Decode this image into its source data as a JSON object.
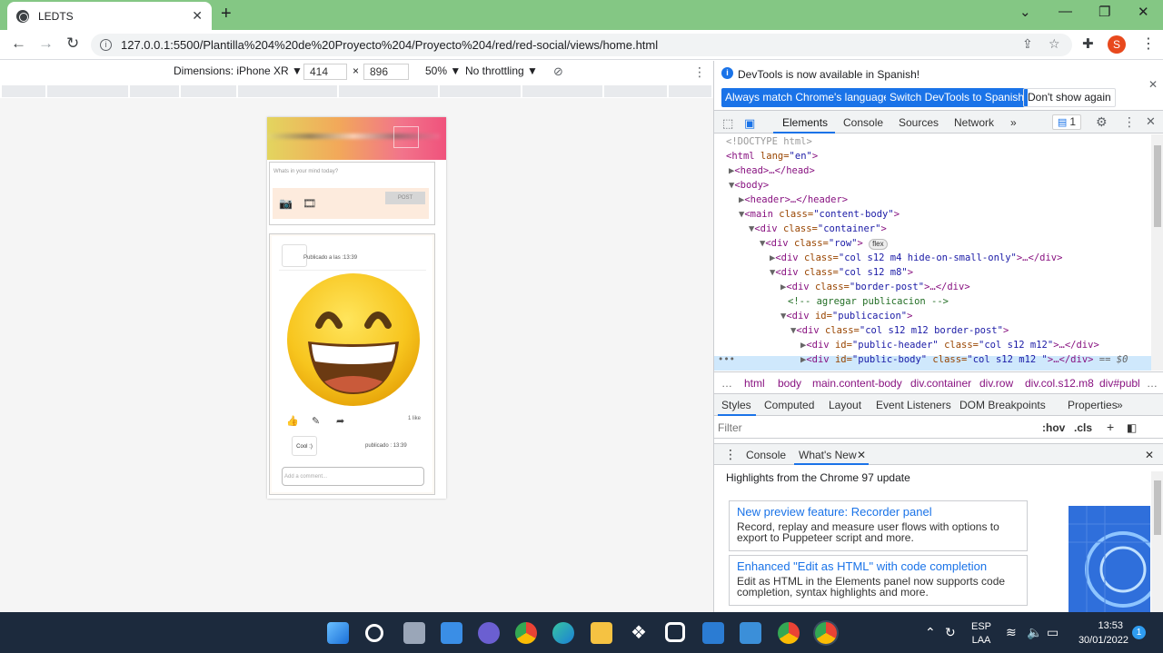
{
  "browser": {
    "tab_title": "LEDTS",
    "tab_close": "✕",
    "new_tab": "+",
    "url": "127.0.0.1:5500/Plantilla%204%20de%20Proyecto%204/Proyecto%204/red/red-social/views/home.html",
    "profile_initial": "S"
  },
  "device_toolbar": {
    "dimensions_label": "Dimensions: iPhone XR ▼",
    "width": "414",
    "times": "×",
    "height": "896",
    "zoom": "50% ▼",
    "throttling": "No throttling ▼"
  },
  "page": {
    "post_placeholder": "Whats in your mind today?",
    "post_button": "POST",
    "published_at": "Publicado a las :13:39",
    "likes": "1 like",
    "comment_text": "Cool :)",
    "comment_time": "publicado : 13:39",
    "comment_placeholder": "Add a comment..."
  },
  "devtools": {
    "banner_message": "DevTools is now available in Spanish!",
    "btn_match": "Always match Chrome's language",
    "btn_switch": "Switch DevTools to Spanish",
    "btn_dont_show": "Don't show again",
    "tabs": [
      "Elements",
      "Console",
      "Sources",
      "Network"
    ],
    "more_tabs": "»",
    "issues_count": "1",
    "dom_lines": {
      "l1": "<!DOCTYPE html>",
      "l2_tag": "<html",
      "l2_attr": " lang=",
      "l2_val": "\"en\"",
      "l2_end": ">",
      "l3": "<head>…</head>",
      "l4": "<body>",
      "l5": "<header>…</header>",
      "l6_tag": "<main",
      "l6_attr": " class=",
      "l6_val": "\"content-body\"",
      "l6_end": ">",
      "l7_tag": "<div",
      "l7_attr": " class=",
      "l7_val": "\"container\"",
      "l7_end": ">",
      "l8_tag": "<div",
      "l8_attr": " class=",
      "l8_val": "\"row\"",
      "l8_end": ">",
      "l8_badge": "flex",
      "l9_tag": "<div",
      "l9_attr": " class=",
      "l9_val": "\"col s12 m4 hide-on-small-only\"",
      "l9_end": ">…</div>",
      "l10_tag": "<div",
      "l10_attr": " class=",
      "l10_val": "\"col s12 m8\"",
      "l10_end": ">",
      "l11_tag": "<div",
      "l11_attr": " class=",
      "l11_val": "\"border-post\"",
      "l11_end": ">…</div>",
      "l12": "<!-- agregar publicacion -->",
      "l13_tag": "<div",
      "l13_attr": " id=",
      "l13_val": "\"publicacion\"",
      "l13_end": ">",
      "l14_tag": "<div",
      "l14_attr": " class=",
      "l14_val": "\"col s12 m12 border-post\"",
      "l14_end": ">",
      "l15_tag": "<div",
      "l15_attr": " id=",
      "l15_val": "\"public-header\"",
      "l15_attr2": " class=",
      "l15_val2": "\"col s12 m12\"",
      "l15_end": ">…</div>",
      "l16_tag": "<div",
      "l16_attr": " id=",
      "l16_val": "\"public-body\"",
      "l16_attr2": " class=",
      "l16_val2": "\"col s12 m12 \"",
      "l16_end": ">…</div>",
      "l16_eq": " == $0"
    },
    "breadcrumbs": [
      "…",
      "html",
      "body",
      "main.content-body",
      "div.container",
      "div.row",
      "div.col.s12.m8",
      "div#publ",
      "…"
    ],
    "styles_tabs": [
      "Styles",
      "Computed",
      "Layout",
      "Event Listeners",
      "DOM Breakpoints",
      "Properties",
      "»"
    ],
    "filter_placeholder": "Filter",
    "hov": ":hov",
    "cls": ".cls",
    "drawer_tabs": [
      "Console",
      "What's New"
    ],
    "whats_new_heading": "Highlights from the Chrome 97 update",
    "cards": [
      {
        "title": "New preview feature: Recorder panel",
        "desc": "Record, replay and measure user flows with options to export to Puppeteer script and more."
      },
      {
        "title": "Enhanced \"Edit as HTML\" with code completion",
        "desc": "Edit as HTML in the Elements panel now supports code completion, syntax highlights and more."
      }
    ]
  },
  "taskbar": {
    "lang_top": "ESP",
    "lang_bottom": "LAA",
    "time": "13:53",
    "date": "30/01/2022",
    "notification_count": "1"
  }
}
